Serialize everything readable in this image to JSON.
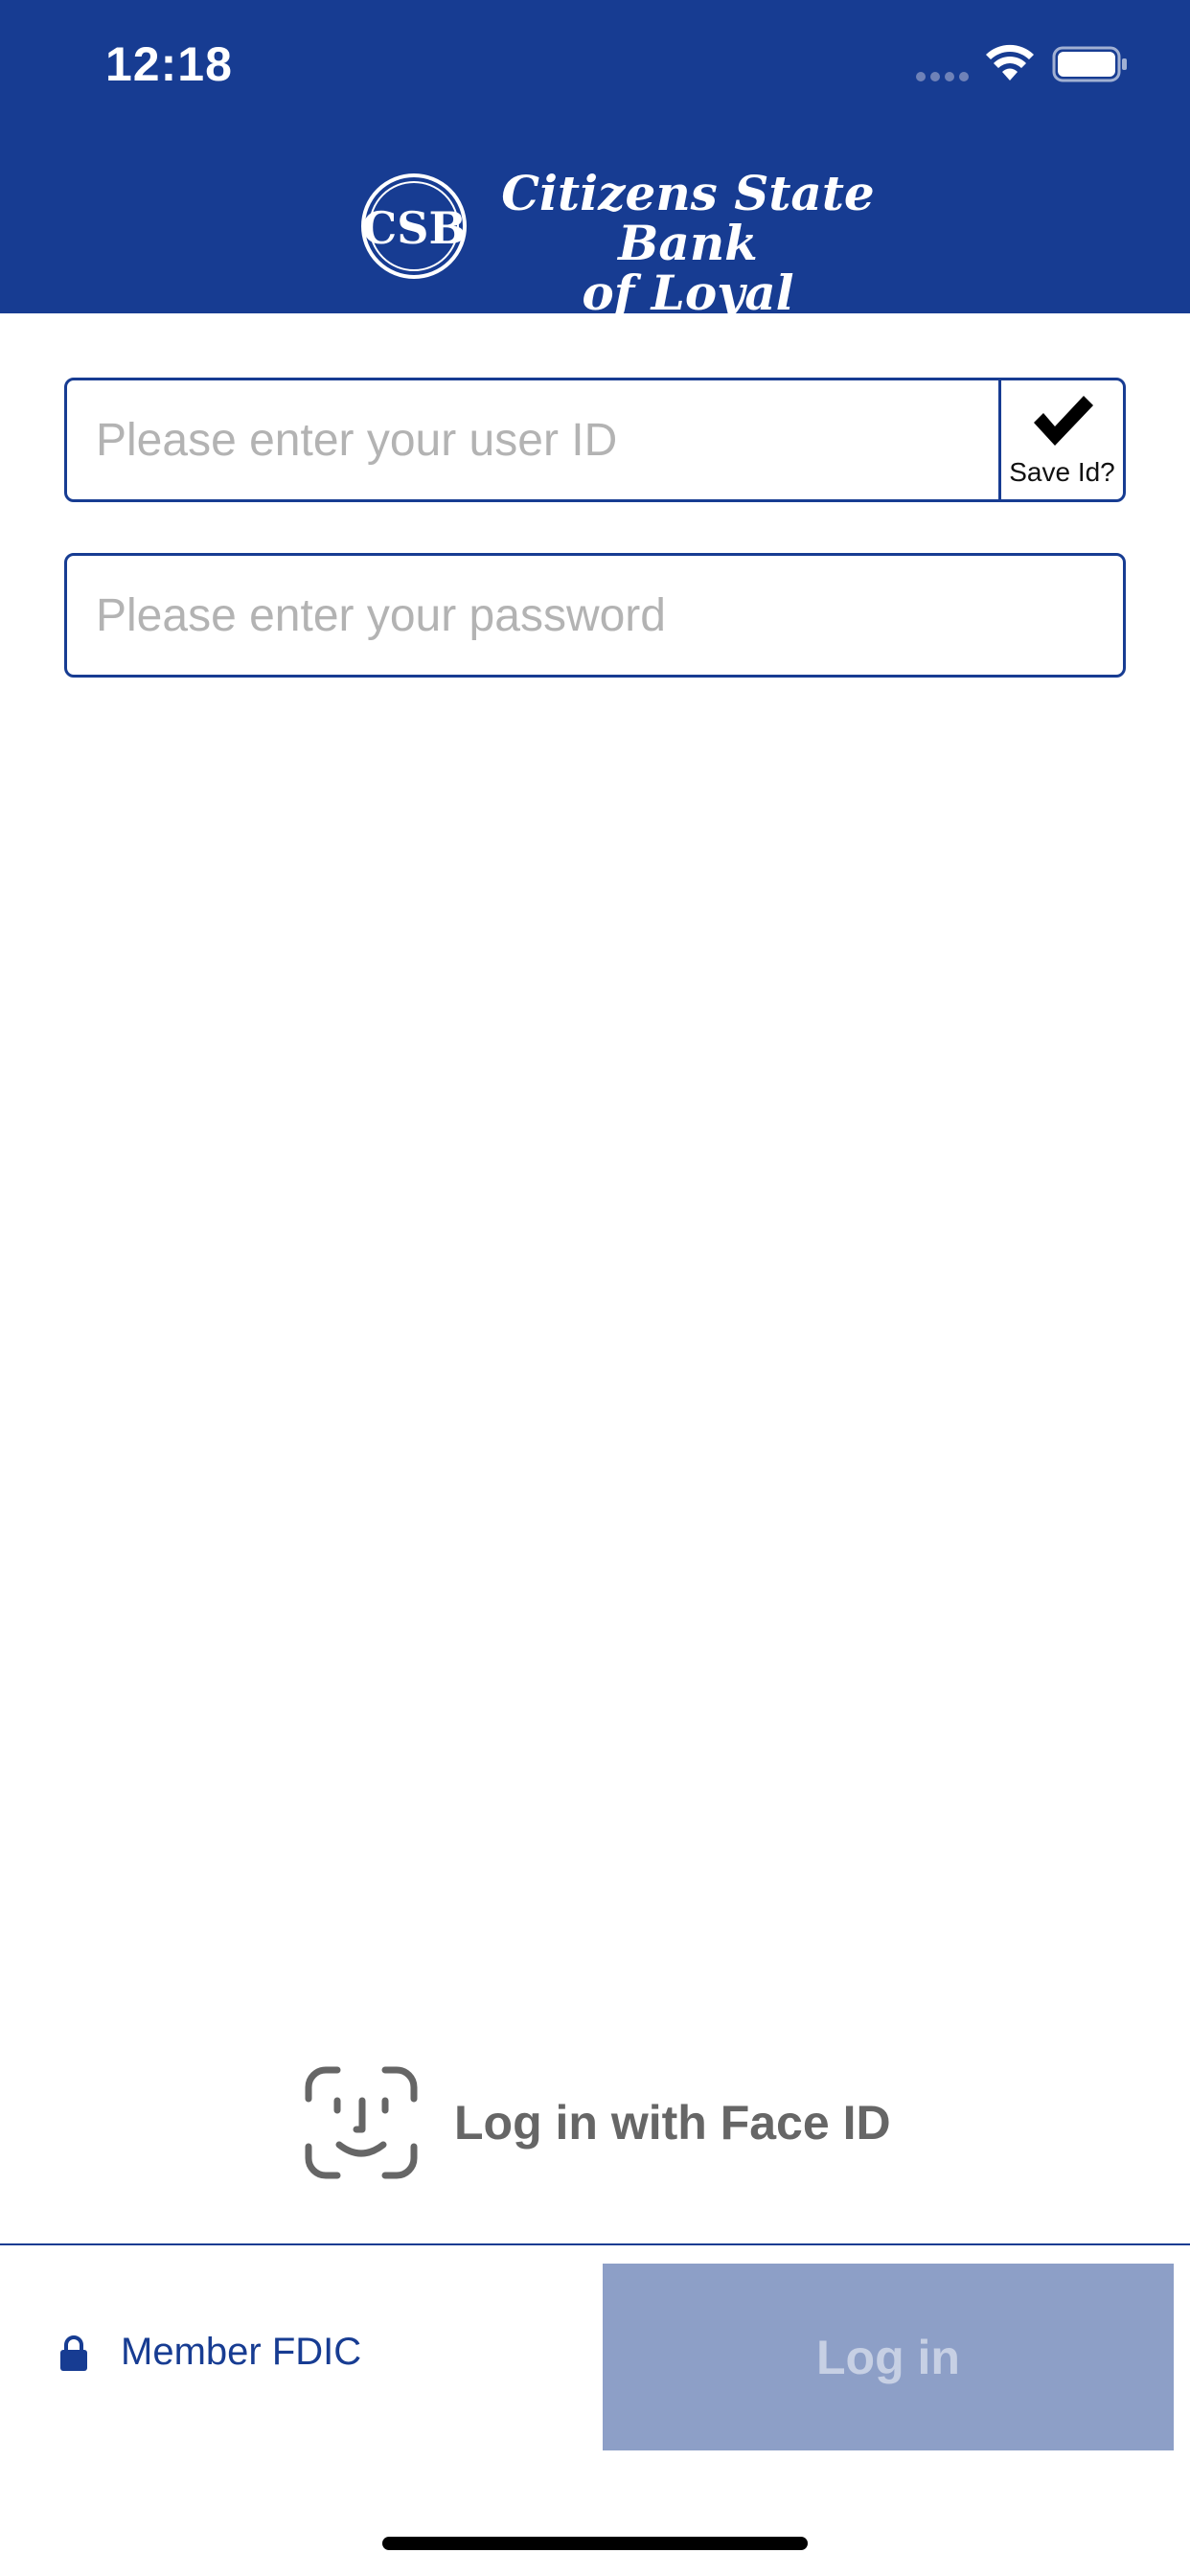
{
  "status_bar": {
    "time": "12:18"
  },
  "header": {
    "logo_text": "CSB",
    "brand_line1": "Citizens State Bank",
    "brand_line2": "of Loyal",
    "background_color": "#173c92"
  },
  "login_form": {
    "user_id_placeholder": "Please enter your user ID",
    "user_id_value": "",
    "save_id_label": "Save Id?",
    "save_id_checked": true,
    "password_placeholder": "Please enter your password",
    "password_value": ""
  },
  "face_id": {
    "label": "Log in with Face ID",
    "icon": "face-id-icon"
  },
  "footer": {
    "fdic_label": "Member FDIC",
    "lock_icon": "lock-icon",
    "login_label": "Log in",
    "login_enabled": false,
    "accent_color": "#173c92",
    "login_button_color": "#8d9fc7"
  }
}
